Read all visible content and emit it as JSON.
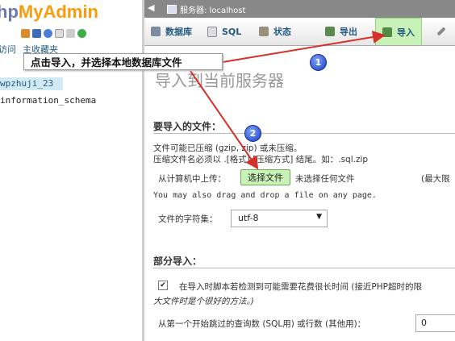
{
  "left": {
    "logo_a": "hp",
    "logo_b": "MyAdmin",
    "tabs": [
      "访问",
      "主收藏夹"
    ],
    "selected_db": "wpzhuji_23",
    "other_db": "information_schema"
  },
  "topbar": {
    "arrow": "◀",
    "server_label": "服务器: localhost"
  },
  "tabs": [
    {
      "label": "数据库",
      "icon": "database-icon"
    },
    {
      "label": "SQL",
      "icon": "sql-icon"
    },
    {
      "label": "状态",
      "icon": "status-icon"
    },
    {
      "label": "导出",
      "icon": "export-icon"
    },
    {
      "label": "导入",
      "icon": "import-icon"
    },
    {
      "label": "",
      "icon": "wrench-icon"
    }
  ],
  "main": {
    "heading": "导入到当前服务器",
    "section1": "要导入的文件：",
    "compress_line1": "文件可能已压缩 (gzip, zip) 或未压缩。",
    "compress_line2": "压缩文件名必须以 .[格式].[压缩方式] 结尾。如：.sql.zip",
    "upload_label": "从计算机中上传：",
    "choose_file": "选择文件",
    "no_file": "未选择任何文件",
    "max_size": "(最大限",
    "drag_drop": "You may also drag and drop a file on any page.",
    "charset_label": "文件的字符集：",
    "charset_value": "utf-8",
    "section2": "部分导入：",
    "partial_text": "在导入时脚本若检测到可能需要花费很长时间 (接近PHP超时的限",
    "partial_text2": "大文件时是个很好的方法。)",
    "skip_label": "从第一个开始跳过的查询数 (SQL用) 或行数 (其他用)：",
    "skip_value": "0"
  },
  "annotations": {
    "callout": "点击导入，并选择本地数据库文件",
    "badge1": "1",
    "badge2": "2",
    "arrow_color": "#d6302a"
  }
}
